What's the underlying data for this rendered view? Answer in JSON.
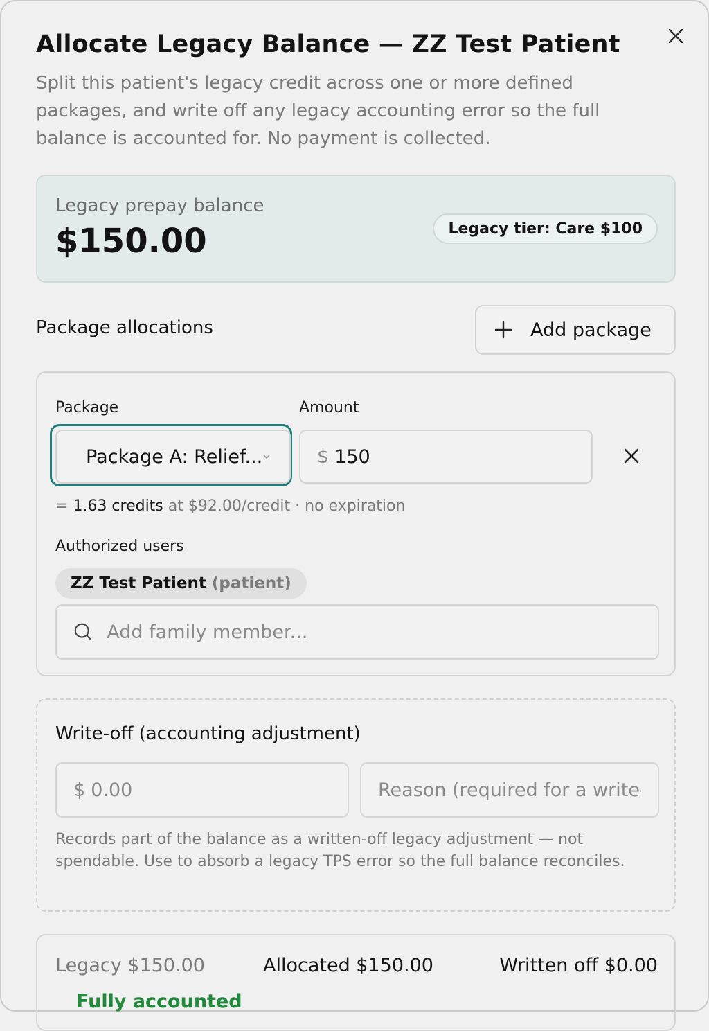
{
  "modal": {
    "title": "Allocate Legacy Balance — ZZ Test Patient",
    "description": "Split this patient's legacy credit across one or more defined packages, and write off any legacy accounting error so the full balance is accounted for. No payment is collected."
  },
  "balance": {
    "label": "Legacy prepay balance",
    "value": "$150.00",
    "tier": "Legacy tier: Care $100"
  },
  "allocations": {
    "section_label": "Package allocations",
    "add_button_label": "Add package",
    "items": [
      {
        "package_label": "Package",
        "package_value": "Package A: Relief...",
        "amount_label": "Amount",
        "currency": "$",
        "amount": "150",
        "credits_prefix": "= ",
        "credits_value": "1.63 credits",
        "credits_rate": " at $92.00/credit · no expiration",
        "authorized_label": "Authorized users",
        "users": [
          {
            "name": "ZZ Test Patient",
            "role": "(patient)"
          }
        ],
        "family_placeholder": "Add family member..."
      }
    ]
  },
  "writeoff": {
    "title": "Write-off (accounting adjustment)",
    "currency": "$",
    "amount_placeholder": "0.00",
    "reason_placeholder": "Reason (required for a write-off)",
    "note": "Records part of the balance as a written-off legacy adjustment — not spendable. Use to absorb a legacy TPS error so the full balance reconciles."
  },
  "summary": {
    "legacy": "Legacy $150.00",
    "allocated": "Allocated $150.00",
    "written_off": "Written off $0.00",
    "status": "Fully accounted"
  },
  "colors": {
    "focus_ring": "#1f7c78",
    "balance_card_bg": "#e2eaea",
    "status_green": "#1f8a3a"
  }
}
